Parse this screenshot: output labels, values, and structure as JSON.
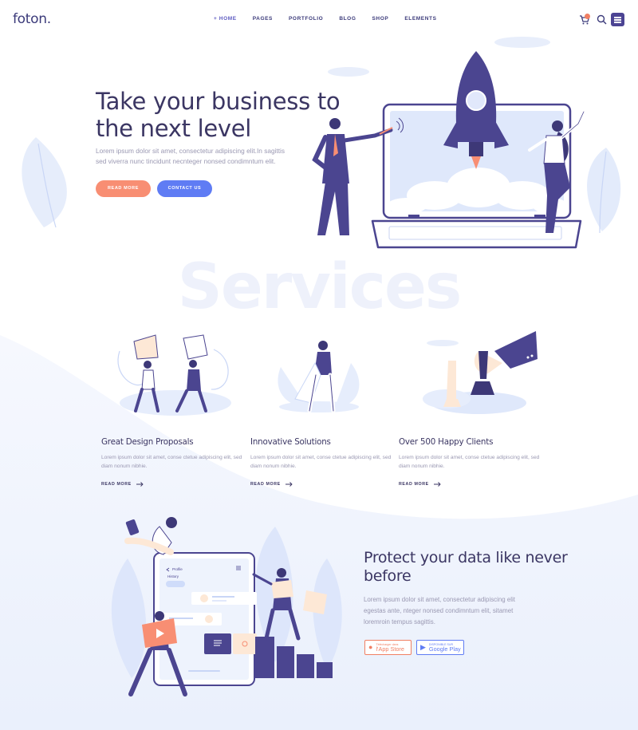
{
  "header": {
    "logo": "foton.",
    "nav": [
      "+ HOME",
      "PAGES",
      "PORTFOLIO",
      "BLOG",
      "SHOP",
      "ELEMENTS"
    ],
    "cart_count": "0"
  },
  "hero": {
    "title": "Take your business to the next level",
    "text": "Lorem ipsum dolor sit amet, consectetur adipiscing elit.In sagittis sed viverra nunc tincidunt necnteger nonsed condimntum elit.",
    "read_more": "READ MORE",
    "contact_us": "CONTACT US"
  },
  "services": {
    "bg_title": "Services",
    "items": [
      {
        "title": "Great Design Proposals",
        "text": "Lorem ipsum dolor sit amet, conse ctetue adipiscing elit, sed diam nonum nibhie.",
        "more": "READ MORE"
      },
      {
        "title": "Innovative Solutions",
        "text": "Lorem ipsum dolor sit amet, conse ctetue adipiscing elit, sed diam nonum nibhie.",
        "more": "READ MORE"
      },
      {
        "title": "Over 500 Happy Clients",
        "text": "Lorem ipsum dolor sit amet, conse ctetue adipiscing elit, sed diam nonum nibhie.",
        "more": "READ MORE"
      }
    ]
  },
  "protect": {
    "title": "Protect your data like never before",
    "text": "Lorem ipsum dolor sit amet, consectetur adipiscing elit egestas ante, nteger nonsed condimntum elit, sitamet loremroin tempus sagittis.",
    "app_store_small": "Télécharger dans",
    "app_store_big": "l'App Store",
    "google_small": "DISPONIBLE SUR",
    "google_big": "Google Play",
    "profile_label": "Profile",
    "history_label": "History"
  },
  "colors": {
    "primary": "#3b3663",
    "accent_orange": "#f88e73",
    "accent_blue": "#5f7cf4",
    "purple": "#4c4493",
    "light_bg": "#eef2fc"
  },
  "icons": [
    "cart-icon",
    "search-icon",
    "menu-icon",
    "arrow-right-icon",
    "apple-icon",
    "play-icon"
  ]
}
